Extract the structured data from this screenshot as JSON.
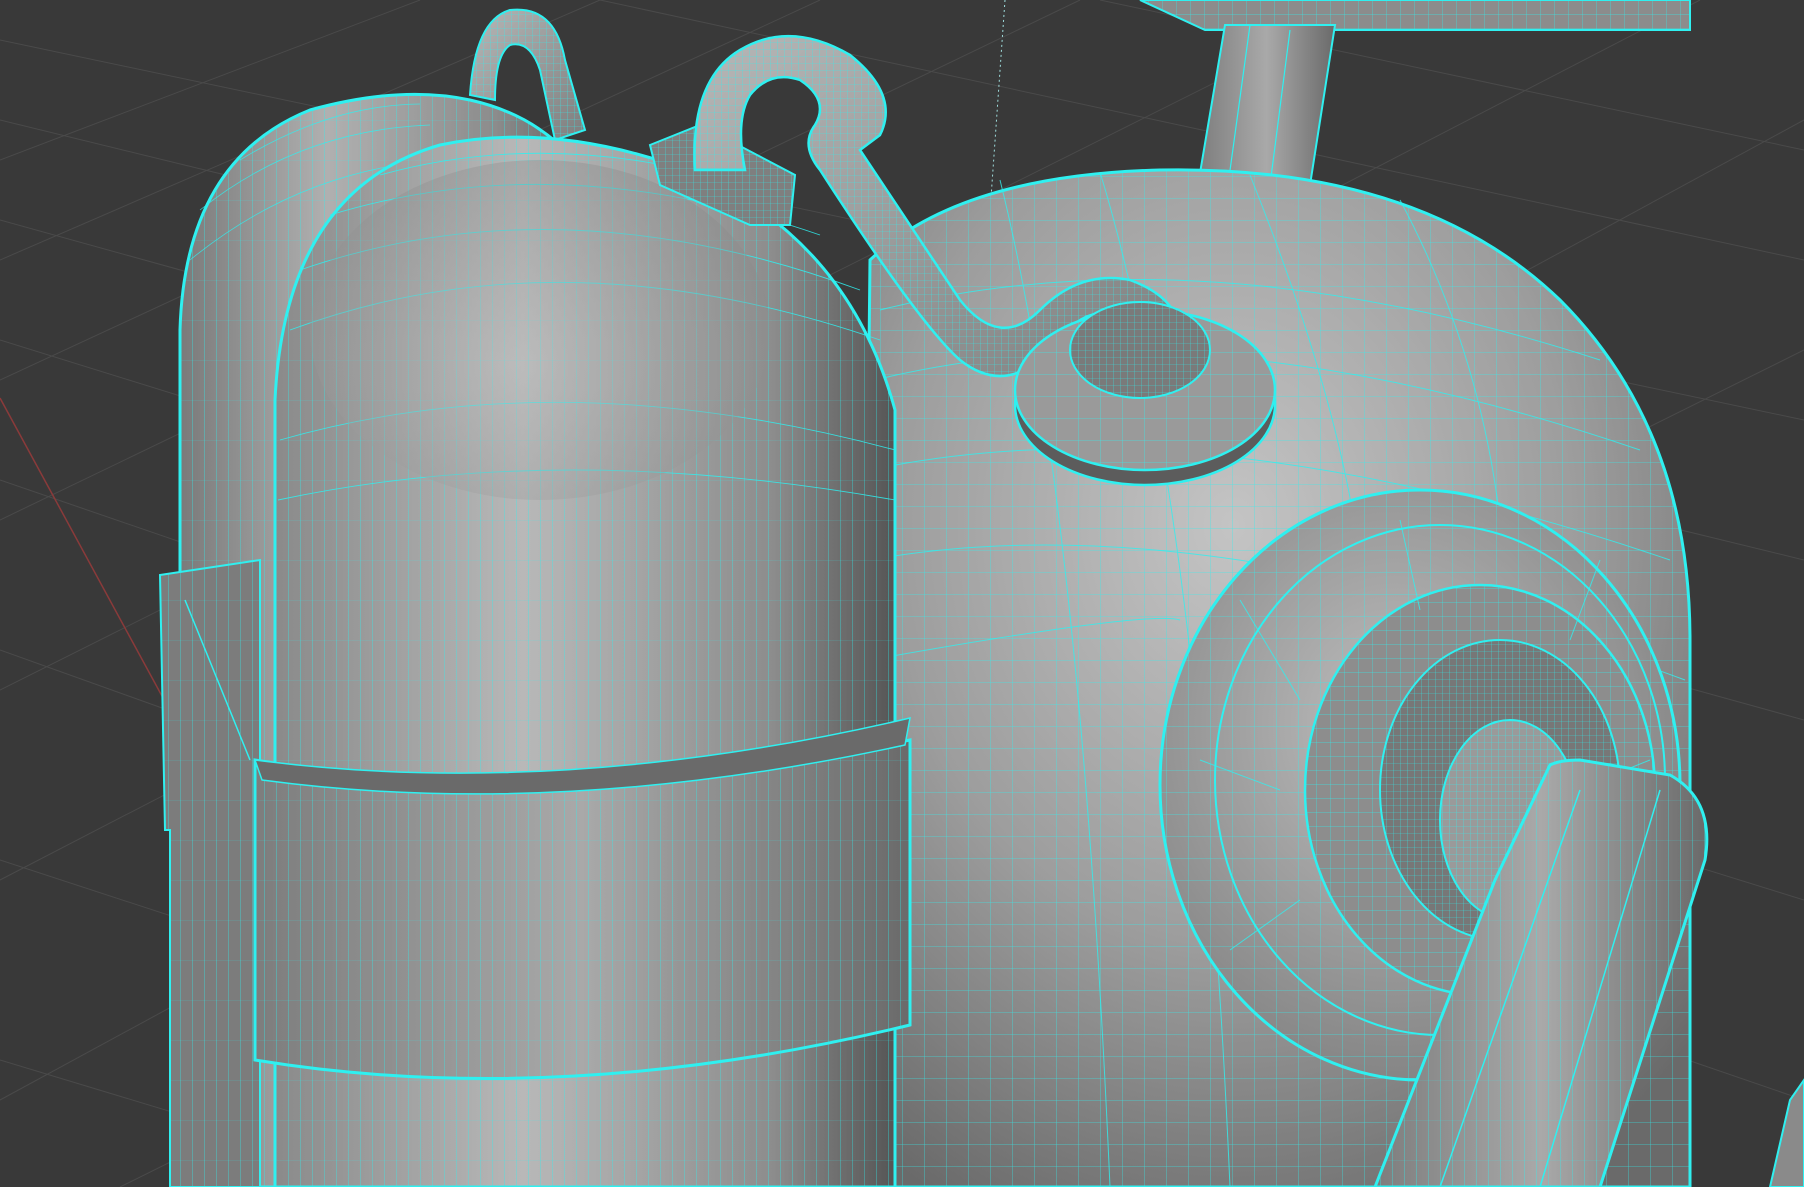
{
  "viewport": {
    "mode": "3d-viewport-wireframe-overlay",
    "selected_object": "backpack-tank-model",
    "colors": {
      "background": "#393939",
      "grid_line": "#4a4a4a",
      "x_axis": "#8a3a3a",
      "wireframe": "#2ff0f0",
      "mesh_light": "#b5b5b5",
      "mesh_mid": "#8e8e8e",
      "mesh_dark": "#5a5a5a"
    },
    "icons": {
      "cursor_line": "3d-cursor-icon",
      "grid": "floor-grid-icon"
    }
  }
}
